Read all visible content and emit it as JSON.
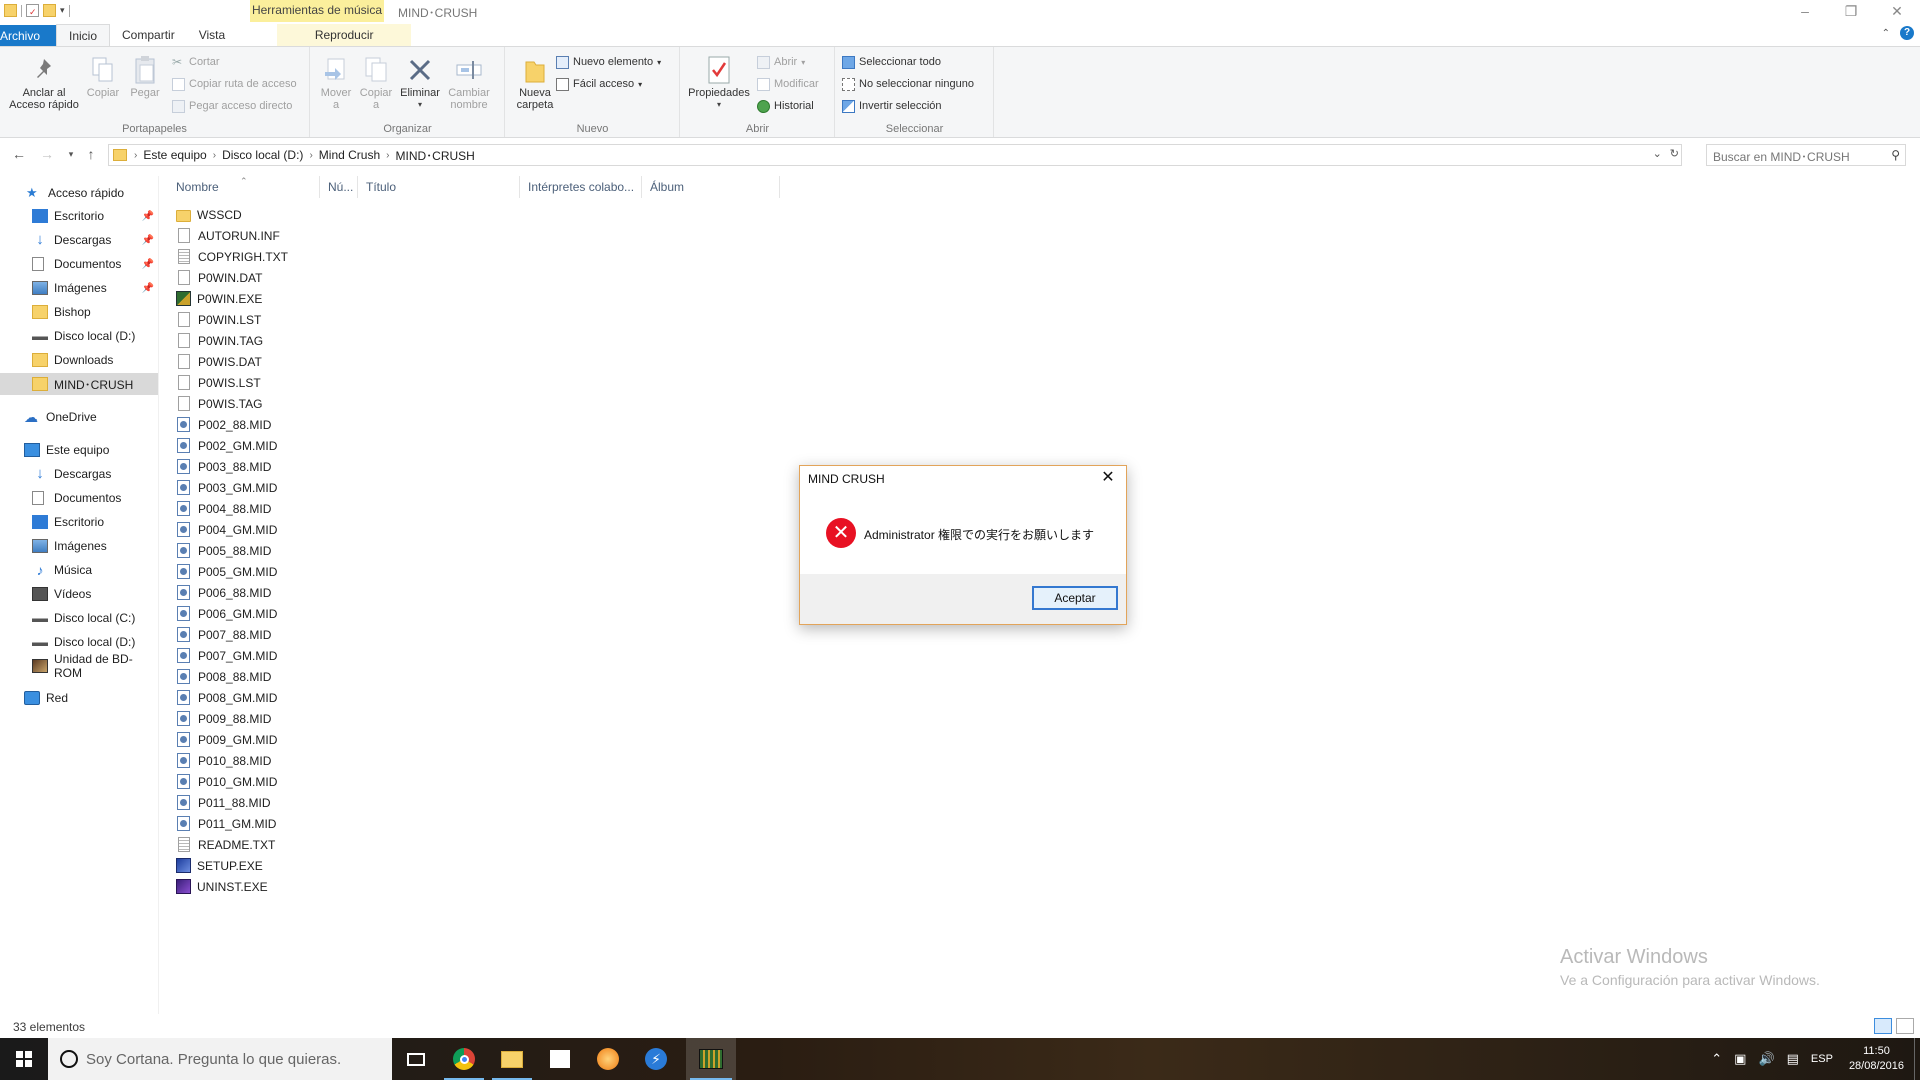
{
  "window": {
    "title": "MIND･CRUSH",
    "context_tab_header": "Herramientas de música"
  },
  "tabs": [
    "Archivo",
    "Inicio",
    "Compartir",
    "Vista",
    "Reproducir"
  ],
  "ribbon": {
    "portapapeles": {
      "label": "Portapapeles",
      "anclar": "Anclar al\nAcceso rápido",
      "copiar": "Copiar",
      "pegar": "Pegar",
      "cortar": "Cortar",
      "copiar_ruta": "Copiar ruta de acceso",
      "pegar_acceso": "Pegar acceso directo"
    },
    "organizar": {
      "label": "Organizar",
      "mover": "Mover\na",
      "copiar": "Copiar\na",
      "eliminar": "Eliminar",
      "cambiar": "Cambiar\nnombre"
    },
    "nuevo": {
      "label": "Nuevo",
      "nueva_carpeta": "Nueva\ncarpeta",
      "nuevo_elemento": "Nuevo elemento",
      "facil_acceso": "Fácil acceso"
    },
    "abrir": {
      "label": "Abrir",
      "propiedades": "Propiedades",
      "abrir": "Abrir",
      "modificar": "Modificar",
      "historial": "Historial"
    },
    "seleccionar": {
      "label": "Seleccionar",
      "todo": "Seleccionar todo",
      "ninguno": "No seleccionar ninguno",
      "invertir": "Invertir selección"
    }
  },
  "address": {
    "crumbs": [
      "Este equipo",
      "Disco local (D:)",
      "Mind Crush",
      "MIND･CRUSH"
    ],
    "search_placeholder": "Buscar en MIND･CRUSH"
  },
  "nav": {
    "acceso_rapido": "Acceso rápido",
    "quick": [
      "Escritorio",
      "Descargas",
      "Documentos",
      "Imágenes",
      "Bishop",
      "Disco local (D:)",
      "Downloads",
      "MIND･CRUSH"
    ],
    "onedrive": "OneDrive",
    "este_equipo": "Este equipo",
    "pc": [
      "Descargas",
      "Documentos",
      "Escritorio",
      "Imágenes",
      "Música",
      "Vídeos",
      "Disco local (C:)",
      "Disco local (D:)",
      "Unidad de BD-ROM"
    ],
    "red": "Red"
  },
  "columns": [
    "Nombre",
    "Nú...",
    "Título",
    "Intérpretes colabo...",
    "Álbum"
  ],
  "files": [
    {
      "name": "WSSCD",
      "type": "folder"
    },
    {
      "name": "AUTORUN.INF",
      "type": "doc"
    },
    {
      "name": "COPYRIGH.TXT",
      "type": "txt"
    },
    {
      "name": "P0WIN.DAT",
      "type": "doc"
    },
    {
      "name": "P0WIN.EXE",
      "type": "exe-green"
    },
    {
      "name": "P0WIN.LST",
      "type": "doc"
    },
    {
      "name": "P0WIN.TAG",
      "type": "doc"
    },
    {
      "name": "P0WIS.DAT",
      "type": "doc"
    },
    {
      "name": "P0WIS.LST",
      "type": "doc"
    },
    {
      "name": "P0WIS.TAG",
      "type": "doc"
    },
    {
      "name": "P002_88.MID",
      "type": "mid"
    },
    {
      "name": "P002_GM.MID",
      "type": "mid"
    },
    {
      "name": "P003_88.MID",
      "type": "mid"
    },
    {
      "name": "P003_GM.MID",
      "type": "mid"
    },
    {
      "name": "P004_88.MID",
      "type": "mid"
    },
    {
      "name": "P004_GM.MID",
      "type": "mid"
    },
    {
      "name": "P005_88.MID",
      "type": "mid"
    },
    {
      "name": "P005_GM.MID",
      "type": "mid"
    },
    {
      "name": "P006_88.MID",
      "type": "mid"
    },
    {
      "name": "P006_GM.MID",
      "type": "mid"
    },
    {
      "name": "P007_88.MID",
      "type": "mid"
    },
    {
      "name": "P007_GM.MID",
      "type": "mid"
    },
    {
      "name": "P008_88.MID",
      "type": "mid"
    },
    {
      "name": "P008_GM.MID",
      "type": "mid"
    },
    {
      "name": "P009_88.MID",
      "type": "mid"
    },
    {
      "name": "P009_GM.MID",
      "type": "mid"
    },
    {
      "name": "P010_88.MID",
      "type": "mid"
    },
    {
      "name": "P010_GM.MID",
      "type": "mid"
    },
    {
      "name": "P011_88.MID",
      "type": "mid"
    },
    {
      "name": "P011_GM.MID",
      "type": "mid"
    },
    {
      "name": "README.TXT",
      "type": "txt"
    },
    {
      "name": "SETUP.EXE",
      "type": "exe-blue"
    },
    {
      "name": "UNINST.EXE",
      "type": "exe-purple"
    }
  ],
  "status": {
    "count": "33 elementos"
  },
  "watermark": {
    "title": "Activar Windows",
    "subtitle": "Ve a Configuración para activar Windows."
  },
  "dialog": {
    "title": "MIND CRUSH",
    "message": "Administrator 権限での実行をお願いします",
    "ok": "Aceptar"
  },
  "taskbar": {
    "cortana": "Soy Cortana. Pregunta lo que quieras.",
    "lang": "ESP",
    "time": "11:50",
    "date": "28/08/2016"
  },
  "colors": {
    "accent": "#1979ca",
    "context_tab": "#fbef9c",
    "error": "#e81123",
    "folder": "#f7d26a"
  }
}
